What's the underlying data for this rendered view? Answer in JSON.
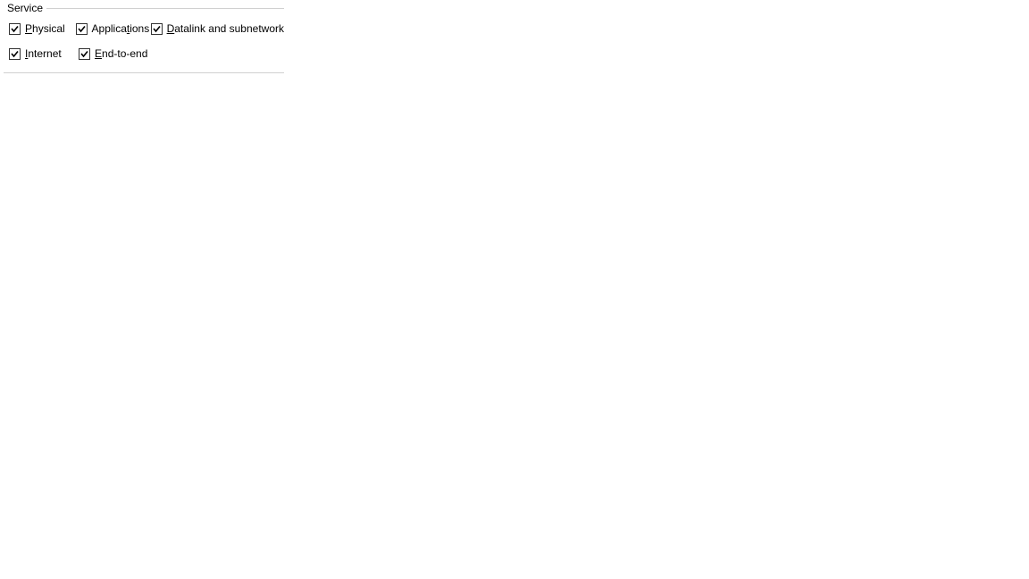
{
  "group": {
    "title": "Service",
    "options": {
      "physical": {
        "checked": true,
        "pre": "",
        "accel": "P",
        "post": "hysical"
      },
      "applications": {
        "checked": true,
        "pre": "Applica",
        "accel": "t",
        "post": "ions"
      },
      "datalink": {
        "checked": true,
        "pre": "",
        "accel": "D",
        "post": "atalink and subnetwork"
      },
      "internet": {
        "checked": true,
        "pre": "",
        "accel": "I",
        "post": "nternet"
      },
      "endtoend": {
        "checked": true,
        "pre": "",
        "accel": "E",
        "post": "nd-to-end"
      }
    }
  }
}
